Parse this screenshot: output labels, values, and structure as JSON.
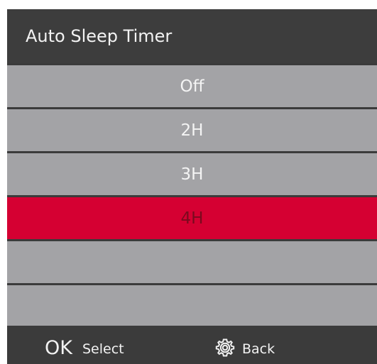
{
  "title": "Auto Sleep Timer",
  "menu": {
    "items": [
      {
        "label": "Off"
      },
      {
        "label": "2H"
      },
      {
        "label": "3H"
      },
      {
        "label": "4H"
      },
      {
        "label": ""
      },
      {
        "label": ""
      }
    ],
    "selected_index": 3
  },
  "footer": {
    "ok_key": "OK",
    "ok_action": "Select",
    "back_icon": "gear-icon",
    "back_action": "Back"
  },
  "colors": {
    "header_bg": "#3d3d3d",
    "item_bg": "#a3a3a6",
    "selected_bg": "#d50032"
  }
}
